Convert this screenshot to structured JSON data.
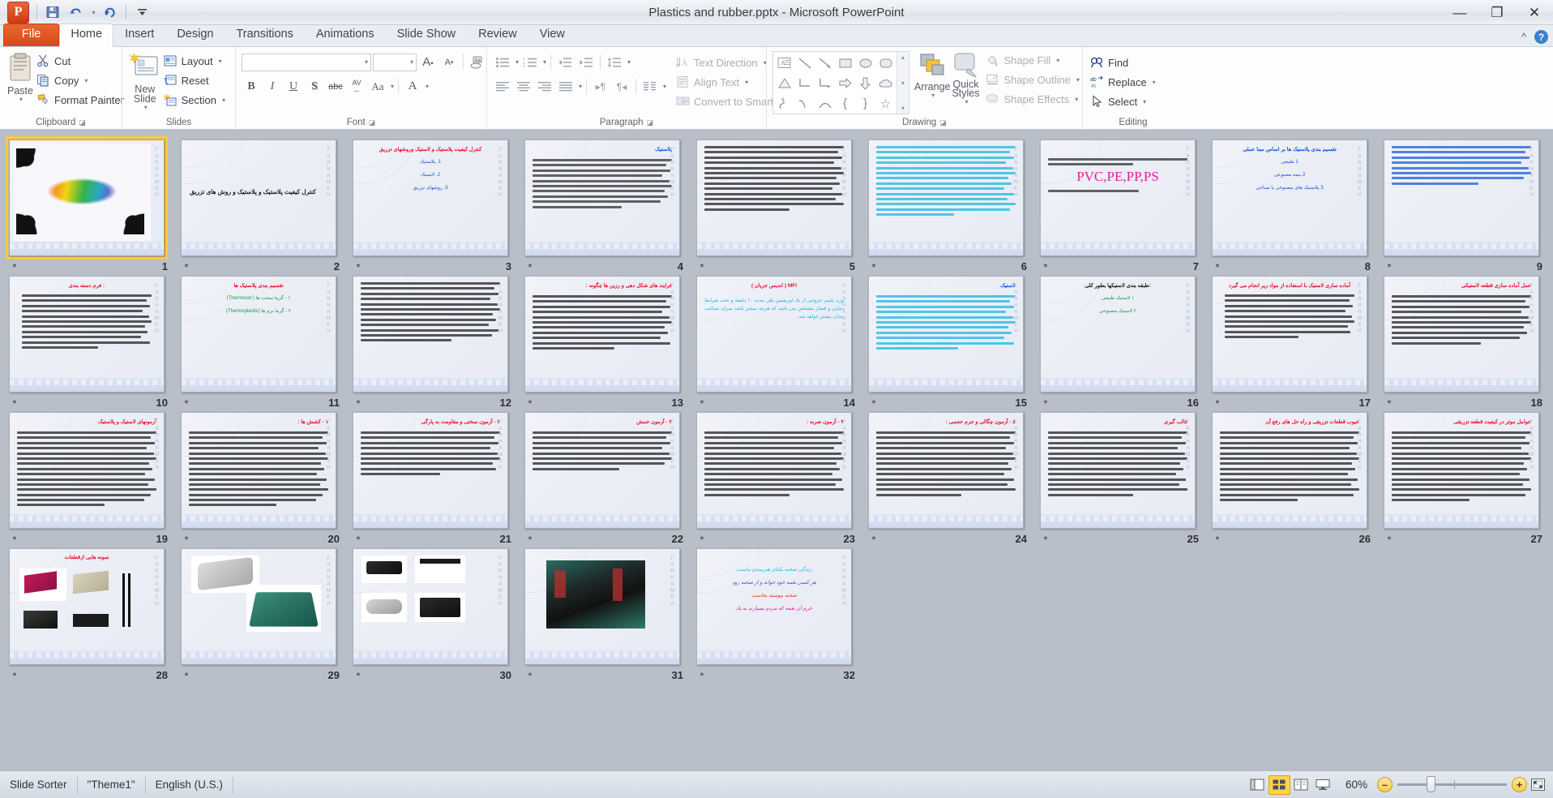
{
  "window": {
    "title": "Plastics and rubber.pptx  -  Microsoft PowerPoint",
    "minimize": "—",
    "restore": "❐",
    "close": "✕",
    "app_logo": "P"
  },
  "quick_access": {
    "save": "save-icon",
    "undo": "undo-icon",
    "redo": "redo-icon",
    "customize": "customize-icon"
  },
  "tabs": [
    {
      "label": "File"
    },
    {
      "label": "Home"
    },
    {
      "label": "Insert"
    },
    {
      "label": "Design"
    },
    {
      "label": "Transitions"
    },
    {
      "label": "Animations"
    },
    {
      "label": "Slide Show"
    },
    {
      "label": "Review"
    },
    {
      "label": "View"
    }
  ],
  "ribbon": {
    "collapse_hint": "^",
    "help": "?",
    "groups": [
      {
        "name": "Clipboard",
        "label": "Clipboard",
        "big": {
          "label": "Paste",
          "caret": "▾"
        },
        "items": [
          {
            "label": "Cut",
            "icon": "scissors-icon"
          },
          {
            "label": "Copy",
            "icon": "copy-icon",
            "caret": "▾"
          },
          {
            "label": "Format Painter",
            "icon": "format-painter-icon"
          }
        ]
      },
      {
        "name": "Slides",
        "label": "Slides",
        "big": {
          "label": "New Slide",
          "caret": "▾"
        },
        "items": [
          {
            "label": "Layout",
            "icon": "layout-icon",
            "caret": "▾"
          },
          {
            "label": "Reset",
            "icon": "reset-icon"
          },
          {
            "label": "Section",
            "icon": "section-icon",
            "caret": "▾"
          }
        ]
      },
      {
        "name": "Font",
        "label": "Font",
        "font_name": "",
        "font_size": "",
        "font_name_placeholder": "",
        "font_size_placeholder": "",
        "row1": [
          "grow-font-icon",
          "shrink-font-icon",
          "clear-formatting-icon"
        ],
        "row2": [
          "bold-icon",
          "italic-icon",
          "underline-icon",
          "shadow-icon",
          "strikethrough-icon",
          "character-spacing-icon",
          "change-case-icon",
          "font-color-icon"
        ],
        "glyphs": {
          "bold": "B",
          "italic": "I",
          "underline": "U",
          "shadow": "S",
          "strike": "abc",
          "spacing": "AV",
          "case": "Aa",
          "color": "A",
          "grow": "A",
          "shrink": "A"
        }
      },
      {
        "name": "Paragraph",
        "label": "Paragraph",
        "items": [
          {
            "label": "Text Direction",
            "icon": "text-direction-icon",
            "caret": "▾"
          },
          {
            "label": "Align Text",
            "icon": "align-text-icon",
            "caret": "▾"
          },
          {
            "label": "Convert to SmartArt",
            "icon": "smartart-icon",
            "caret": "▾"
          }
        ]
      },
      {
        "name": "Drawing",
        "label": "Drawing",
        "shapes": [
          "▣",
          "╲",
          "➘",
          "▭",
          "⬭",
          "▢",
          "△",
          "⌐",
          "⌐",
          "⇨",
          "⇩",
          "◠",
          "⌇",
          "⌒",
          "∩",
          "{",
          "}",
          "☆"
        ],
        "arrange": {
          "label": "Arrange",
          "caret": "▾"
        },
        "quick_styles": {
          "label": "Quick Styles",
          "caret": "▾"
        },
        "items": [
          {
            "label": "Shape Fill",
            "icon": "shape-fill-icon",
            "caret": "▾"
          },
          {
            "label": "Shape Outline",
            "icon": "shape-outline-icon",
            "caret": "▾"
          },
          {
            "label": "Shape Effects",
            "icon": "shape-effects-icon",
            "caret": "▾"
          }
        ]
      },
      {
        "name": "Editing",
        "label": "Editing",
        "items": [
          {
            "label": "Find",
            "icon": "find-icon"
          },
          {
            "label": "Replace",
            "icon": "replace-icon",
            "caret": "▾"
          },
          {
            "label": "Select",
            "icon": "select-icon",
            "caret": "▾"
          }
        ]
      }
    ]
  },
  "status": {
    "view_mode": "Slide Sorter",
    "theme": "\"Theme1\"",
    "language": "English (U.S.)",
    "zoom_level": "60%",
    "zoom_out": "–",
    "zoom_in": "+",
    "view_buttons": [
      {
        "name": "normal-view",
        "glyph": "▤",
        "active": false
      },
      {
        "name": "slide-sorter-view",
        "glyph": "▦",
        "active": true
      },
      {
        "name": "reading-view",
        "glyph": "▥",
        "active": false
      },
      {
        "name": "slide-show-view",
        "glyph": "▭",
        "active": false
      }
    ],
    "fit_to_window": "fit-slide-icon"
  },
  "slides": [
    {
      "n": 1,
      "selected": true,
      "kind": "image-calligraphy",
      "title": "",
      "title_color": "",
      "lines": []
    },
    {
      "n": 2,
      "kind": "title-only",
      "title_color": "dark",
      "title": "کنترل کیفیت پلاستیک و پلاستیک و روش های تزریق",
      "lines": []
    },
    {
      "n": 3,
      "kind": "title-list",
      "title_color": "red",
      "title": "کنترل کیفیت پلاستیک و لاستیک وروشهای تزریق",
      "lines": [
        "1.  پلاستیک",
        "2.  لاستیک",
        "3.  روشهای تزریق"
      ],
      "line_color": "blue"
    },
    {
      "n": 4,
      "kind": "title-paragraph",
      "title_color": "blue",
      "title": "پلاستیک",
      "lines": [
        "پلاستیک چیست ؟"
      ],
      "body_lines": 10
    },
    {
      "n": 5,
      "kind": "paragraph",
      "title": "",
      "body_lines": 13,
      "body_color": "dark"
    },
    {
      "n": 6,
      "kind": "paragraph",
      "title": "",
      "body_lines": 14,
      "body_color": "cyan"
    },
    {
      "n": 7,
      "kind": "big-text",
      "title": "",
      "big_text": "PVC,PE,PP,PS",
      "big_color": "#e41fa0",
      "body_lines": 3
    },
    {
      "n": 8,
      "kind": "title-list",
      "title_color": "blue",
      "title": "تقسیم بندی پلاستیک ها بر اساس مبنا عملی",
      "lines": [
        "1   طبیعی",
        "2   نیمه مصنوعی",
        "3   پلاستیک های مصنوعی یا صناعی"
      ],
      "line_color": "blue"
    },
    {
      "n": 9,
      "kind": "paragraph",
      "title": "",
      "body_lines": 8,
      "body_color": "blue"
    },
    {
      "n": 10,
      "kind": "title-list",
      "title_color": "red",
      "title": "فرم دسته بندی :",
      "lines": [],
      "body_lines": 11,
      "body_color": "dark"
    },
    {
      "n": 11,
      "kind": "title-list",
      "title_color": "red",
      "title": "تقسیم بندی پلاستیک ها",
      "lines": [
        "۱ - گرما سخت ها ( Thermoset)",
        "۲ - گرما نرم ها (Thermoplastic)"
      ],
      "line_color": "green"
    },
    {
      "n": 12,
      "kind": "paragraph",
      "title": "",
      "body_lines": 12,
      "body_color": "dark"
    },
    {
      "n": 13,
      "kind": "title-paragraph",
      "title_color": "red",
      "title": "فرایند های شکل دهی و رزین ها چگونه :",
      "body_lines": 11,
      "body_color": "dark"
    },
    {
      "n": 14,
      "kind": "title-paragraph",
      "title_color": "red",
      "title": "MFI ( اندیس جریان )",
      "body_text": "وزن پلیمر خروجی از یک اوریفیس طی مدت ۱۰ دقیقه و تحت شرایط دمایی و فشار مشخص می باشد که هرچه بیشتر باشد میزان سیالیت مذاب بیشتر خواهد شد .",
      "body_color": "cyan",
      "body_lines": 6
    },
    {
      "n": 15,
      "kind": "title-paragraph",
      "title_color": "blue",
      "title": "لاستیک",
      "body_lines": 11,
      "body_color": "cyan"
    },
    {
      "n": 16,
      "kind": "title-list",
      "title_color": "dark",
      "title": "طبقه بندی لاستیکها بطور کلی:",
      "lines": [
        "۱   لاستیک طبیعی",
        "۲   لاستیک مصنوعی"
      ],
      "line_color": "green"
    },
    {
      "n": 17,
      "kind": "title-list",
      "title_color": "red",
      "title": "آماده سازی لاستیک با استفاده از مواد زیر انجام می گیرد",
      "body_lines": 9,
      "body_color": "dark"
    },
    {
      "n": 18,
      "kind": "title-paragraph",
      "title_color": "red",
      "title": "عمل آماده سازی قطعه لاستیکی",
      "body_lines": 10,
      "body_color": "dark"
    },
    {
      "n": 19,
      "kind": "title-paragraph",
      "title_color": "red",
      "title": "آزمونهای لاستیک و پلاستیک",
      "body_lines": 15,
      "body_color": "dark"
    },
    {
      "n": 20,
      "kind": "title-paragraph",
      "title_color": "red",
      "title": "۱ - کشش ها :",
      "body_lines": 15,
      "body_color": "dark"
    },
    {
      "n": 21,
      "kind": "title-paragraph",
      "title_color": "red",
      "title": "۲ - آزمون سختی و مقاومت به پارگی",
      "body_lines": 9,
      "body_color": "dark"
    },
    {
      "n": 22,
      "kind": "title-paragraph",
      "title_color": "red",
      "title": "۳ - آزمون خمش",
      "body_lines": 8,
      "body_color": "dark"
    },
    {
      "n": 23,
      "kind": "title-paragraph",
      "title_color": "red",
      "title": "۴ - آزمون ضربه :",
      "body_lines": 13,
      "body_color": "dark"
    },
    {
      "n": 24,
      "kind": "title-paragraph",
      "title_color": "red",
      "title": "۵ - آزمون چگالی و جرم حجمی :",
      "body_lines": 13,
      "body_color": "dark"
    },
    {
      "n": 25,
      "kind": "title-paragraph",
      "title_color": "red",
      "title": "قالب گیری",
      "body_lines": 13,
      "body_color": "dark"
    },
    {
      "n": 26,
      "kind": "title-paragraph",
      "title_color": "red",
      "title": "عیوب قطعات تزریقی و راه حل های رفع آن",
      "body_lines": 14,
      "body_color": "dark"
    },
    {
      "n": 27,
      "kind": "title-paragraph",
      "title_color": "red",
      "title": "عوامل موثر در کیفیت قطعه تزریقی",
      "body_lines": 14,
      "body_color": "dark"
    },
    {
      "n": 28,
      "kind": "image-grid",
      "title_color": "red",
      "title": "نمونه هایی ازقطعات"
    },
    {
      "n": 29,
      "kind": "image-two",
      "title": ""
    },
    {
      "n": 30,
      "kind": "image-four",
      "title": ""
    },
    {
      "n": 31,
      "kind": "image-photo",
      "title": ""
    },
    {
      "n": 32,
      "kind": "poem",
      "title": "",
      "poem": [
        {
          "text": "زندگی صحنه یکتای هنرمندی ماست",
          "color": "#2bb8e8"
        },
        {
          "text": "هر کسی نغمه خود خواند و از صحنه رود",
          "color": "#6a3fd6"
        },
        {
          "text": "صحنه پیوسته بجاست",
          "color": "#e8401f"
        },
        {
          "text": "خرم آن نغمه که مردم بسپارند به یاد",
          "color": "#e31d84"
        }
      ]
    }
  ],
  "thumb_sidebar_text": "FARHAMEH",
  "colors": {
    "accent_orange": "#d6491a",
    "selection_gold": "#ffc83d",
    "workspace_gray": "#b8bfc9"
  }
}
